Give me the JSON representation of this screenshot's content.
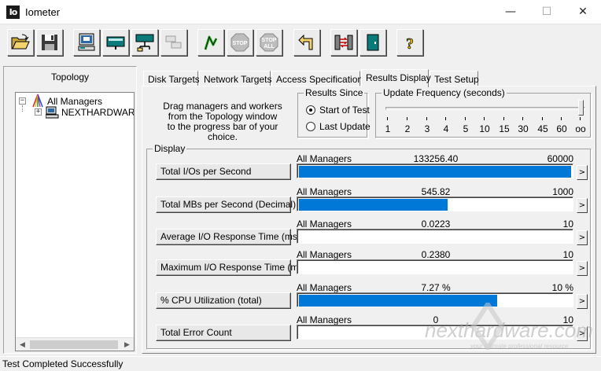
{
  "window": {
    "title": "Iometer",
    "icon_text": "Io",
    "min_glyph": "—",
    "max_glyph": "☐",
    "close_glyph": "✕"
  },
  "toolbar": {
    "buttons": [
      {
        "name": "open-config",
        "icon": "folder-open-icon"
      },
      {
        "name": "save-config",
        "icon": "floppy-disk-icon"
      },
      {
        "name": "start-disk-worker",
        "icon": "disk-worker-icon"
      },
      {
        "name": "start-network-worker",
        "icon": "network-worker-icon"
      },
      {
        "name": "duplicate-worker",
        "icon": "duplicate-worker-icon"
      },
      {
        "name": "start-tests",
        "icon": "green-flag-icon"
      },
      {
        "name": "stop-test",
        "icon": "stop-icon",
        "label": "STOP"
      },
      {
        "name": "stop-all",
        "icon": "stop-all-icon",
        "label": "STOP",
        "label2": "ALL"
      },
      {
        "name": "reset-workers",
        "icon": "reset-arrow-icon"
      },
      {
        "name": "refresh-targets",
        "icon": "refresh-targets-icon"
      },
      {
        "name": "exit",
        "icon": "exit-door-icon"
      },
      {
        "name": "about",
        "icon": "help-question-icon",
        "label": "?"
      }
    ]
  },
  "topology": {
    "title": "Topology",
    "root": "All Managers",
    "children": [
      "NEXTHARDWAR"
    ],
    "expand_glyph": "−",
    "collapse_glyph": "+",
    "scroll_left": "◀",
    "scroll_right": "▶"
  },
  "tabs": [
    "Disk Targets",
    "Network Targets",
    "Access Specifications",
    "Results Display",
    "Test Setup"
  ],
  "active_tab": "Results Display",
  "results_display": {
    "drag_hint_lines": [
      "Drag managers and workers",
      "from the Topology window",
      "to the progress bar of your choice."
    ],
    "results_since": {
      "label": "Results Since",
      "options": [
        {
          "label": "Start of Test",
          "selected": true
        },
        {
          "label": "Last Update",
          "selected": false
        }
      ]
    },
    "update_frequency": {
      "label": "Update Frequency (seconds)",
      "ticks": [
        "1",
        "2",
        "3",
        "4",
        "5",
        "10",
        "15",
        "30",
        "45",
        "60",
        "oo"
      ],
      "selected": "oo"
    },
    "display_label": "Display",
    "metrics": [
      {
        "button": "Total I/Os per Second",
        "source": "All Managers",
        "value": "133256.40",
        "max": "60000",
        "fill": 1.0
      },
      {
        "button": "Total MBs per Second (Decimal)",
        "source": "All Managers",
        "value": "545.82",
        "max": "1000",
        "fill": 0.546
      },
      {
        "button": "Average I/O Response Time (ms)",
        "source": "All Managers",
        "value": "0.0223",
        "max": "10",
        "fill": 0.0
      },
      {
        "button": "Maximum I/O Response Time (ms)",
        "source": "All Managers",
        "value": "0.2380",
        "max": "10",
        "fill": 0.0
      },
      {
        "button": "% CPU Utilization (total)",
        "source": "All Managers",
        "value": "7.27 %",
        "max": "10 %",
        "fill": 0.727
      },
      {
        "button": "Total Error Count",
        "source": "All Managers",
        "value": "0",
        "max": "10",
        "fill": 0.0
      }
    ],
    "arrow_glyph": ">"
  },
  "status": {
    "text": "Test Completed Successfully"
  },
  "watermark": {
    "text": "nexthardware.com",
    "tagline": "your ultimate professional resource"
  },
  "colors": {
    "bar": "#0078d7",
    "face": "#f0f0f0"
  }
}
